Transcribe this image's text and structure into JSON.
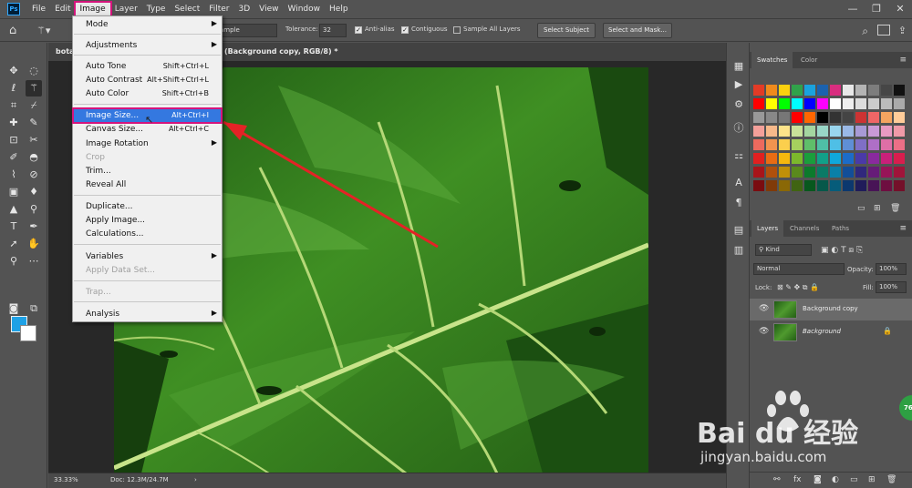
{
  "app": {
    "logo": "Ps"
  },
  "menu": [
    "File",
    "Edit",
    "Image",
    "Layer",
    "Type",
    "Select",
    "Filter",
    "3D",
    "View",
    "Window",
    "Help"
  ],
  "window_controls": [
    "—",
    "❐",
    "✕"
  ],
  "options_bar": {
    "sample_value": "ample",
    "tolerance_label": "Tolerance:",
    "tolerance_value": "32",
    "antialias_label": "Anti-alias",
    "contiguous_label": "Contiguous",
    "sample_all_label": "Sample All Layers",
    "select_subject_label": "Select Subject",
    "select_mask_label": "Select and Mask..."
  },
  "document": {
    "tab_left": "bota",
    "tab_title": "(Background copy, RGB/8) *",
    "zoom": "33.33%",
    "doc_info": "Doc: 12.3M/24.7M"
  },
  "image_menu": {
    "items": [
      {
        "label": "Mode",
        "shortcut": "",
        "submenu": true,
        "disabled": false
      },
      {
        "label": "Adjustments",
        "shortcut": "",
        "submenu": true,
        "disabled": false
      },
      {
        "label": "Auto Tone",
        "shortcut": "Shift+Ctrl+L",
        "submenu": false,
        "disabled": false
      },
      {
        "label": "Auto Contrast",
        "shortcut": "Alt+Shift+Ctrl+L",
        "submenu": false,
        "disabled": false
      },
      {
        "label": "Auto Color",
        "shortcut": "Shift+Ctrl+B",
        "submenu": false,
        "disabled": false
      },
      {
        "label": "Image Size...",
        "shortcut": "Alt+Ctrl+I",
        "submenu": false,
        "disabled": false,
        "highlighted": true
      },
      {
        "label": "Canvas Size...",
        "shortcut": "Alt+Ctrl+C",
        "submenu": false,
        "disabled": false
      },
      {
        "label": "Image Rotation",
        "shortcut": "",
        "submenu": true,
        "disabled": false
      },
      {
        "label": "Crop",
        "shortcut": "",
        "submenu": false,
        "disabled": true
      },
      {
        "label": "Trim...",
        "shortcut": "",
        "submenu": false,
        "disabled": false
      },
      {
        "label": "Reveal All",
        "shortcut": "",
        "submenu": false,
        "disabled": false
      },
      {
        "label": "Duplicate...",
        "shortcut": "",
        "submenu": false,
        "disabled": false
      },
      {
        "label": "Apply Image...",
        "shortcut": "",
        "submenu": false,
        "disabled": false
      },
      {
        "label": "Calculations...",
        "shortcut": "",
        "submenu": false,
        "disabled": false
      },
      {
        "label": "Variables",
        "shortcut": "",
        "submenu": true,
        "disabled": false
      },
      {
        "label": "Apply Data Set...",
        "shortcut": "",
        "submenu": false,
        "disabled": true
      },
      {
        "label": "Trap...",
        "shortcut": "",
        "submenu": false,
        "disabled": true
      },
      {
        "label": "Analysis",
        "shortcut": "",
        "submenu": true,
        "disabled": false
      }
    ]
  },
  "swatches_panel": {
    "tabs": [
      "Swatches",
      "Color"
    ],
    "rows": [
      [
        "#e33b26",
        "#f08a1c",
        "#fbd10e",
        "#30a24a",
        "#1aa2dd",
        "#1b62ae",
        "#d82d7f",
        "#e8e8e8",
        "#b4b4b4",
        "#7d7d7d",
        "#464646",
        "#111111"
      ],
      [
        "#ff0000",
        "#ffff00",
        "#00ff00",
        "#00ffff",
        "#0000ff",
        "#ff00ff",
        "#ffffff",
        "#eeeeee",
        "#dddddd",
        "#cccccc",
        "#bbbbbb",
        "#aaaaaa"
      ],
      [
        "#999999",
        "#888888",
        "#777777",
        "#ff0000",
        "#ff6600",
        "#000000",
        "#333333",
        "#444444",
        "#cc3333",
        "#ee6666",
        "#f4a460",
        "#ffcc99"
      ],
      [
        "#f4a09a",
        "#f7b98a",
        "#fde38a",
        "#c9e29a",
        "#a4d6a0",
        "#99d6c7",
        "#99d6ee",
        "#9ab9e6",
        "#a89ad6",
        "#c99ad6",
        "#e89ac2",
        "#f09aa8"
      ],
      [
        "#ec6a5e",
        "#f2944f",
        "#fbcf4d",
        "#a6d05e",
        "#5fbf6a",
        "#4fbfa6",
        "#4fbfe6",
        "#5f8fd6",
        "#7f6fc6",
        "#af6fc6",
        "#df6fa6",
        "#ec6f86"
      ],
      [
        "#e02020",
        "#e86c14",
        "#f6b80e",
        "#7cb82c",
        "#1a9e3c",
        "#12a089",
        "#10a8dc",
        "#1c6cc8",
        "#4a3aa8",
        "#8a2a9e",
        "#c8207a",
        "#d81e4e"
      ],
      [
        "#a8141a",
        "#b0500c",
        "#c09008",
        "#5a8a1c",
        "#0c7a2c",
        "#0a7a66",
        "#0a80a8",
        "#124e98",
        "#30287c",
        "#661c78",
        "#981458",
        "#a0143a"
      ],
      [
        "#7a0c10",
        "#803a08",
        "#8a6806",
        "#406412",
        "#08581e",
        "#06584a",
        "#065c7a",
        "#0c386e",
        "#201c5a",
        "#481456",
        "#6e0e40",
        "#74102a"
      ]
    ]
  },
  "layers_panel": {
    "tabs": [
      "Layers",
      "Channels",
      "Paths"
    ],
    "filter_label": "Kind",
    "blend_mode": "Normal",
    "opacity_label": "Opacity:",
    "opacity_value": "100%",
    "lock_label": "Lock:",
    "fill_label": "Fill:",
    "fill_value": "100%",
    "layers": [
      {
        "name": "Background copy",
        "selected": true
      },
      {
        "name": "Background",
        "selected": false,
        "locked": true
      }
    ]
  },
  "watermark": {
    "brand": "Bai du 经验",
    "url": "jingyan.baidu.com"
  },
  "badge": {
    "value": "76"
  }
}
